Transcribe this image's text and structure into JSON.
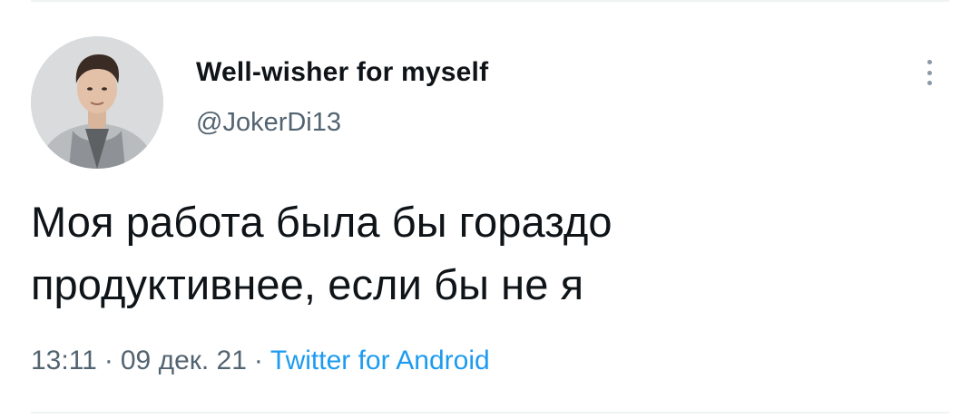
{
  "tweet": {
    "author": {
      "display_name": "Well-wisher for myself",
      "handle": "@JokerDi13",
      "avatar_icon": "profile-photo"
    },
    "text_lines": [
      "Моя работа была бы гораздо",
      "продуктивнее, если бы не я"
    ],
    "meta": {
      "time": "13:11",
      "separator": "·",
      "date": "09 дек. 21",
      "source": "Twitter for Android"
    },
    "more_icon": "more-vertical-icon"
  },
  "colors": {
    "text_primary": "#0f1419",
    "text_secondary": "#536471",
    "link": "#1d9bf0",
    "divider": "#eff3f4"
  }
}
